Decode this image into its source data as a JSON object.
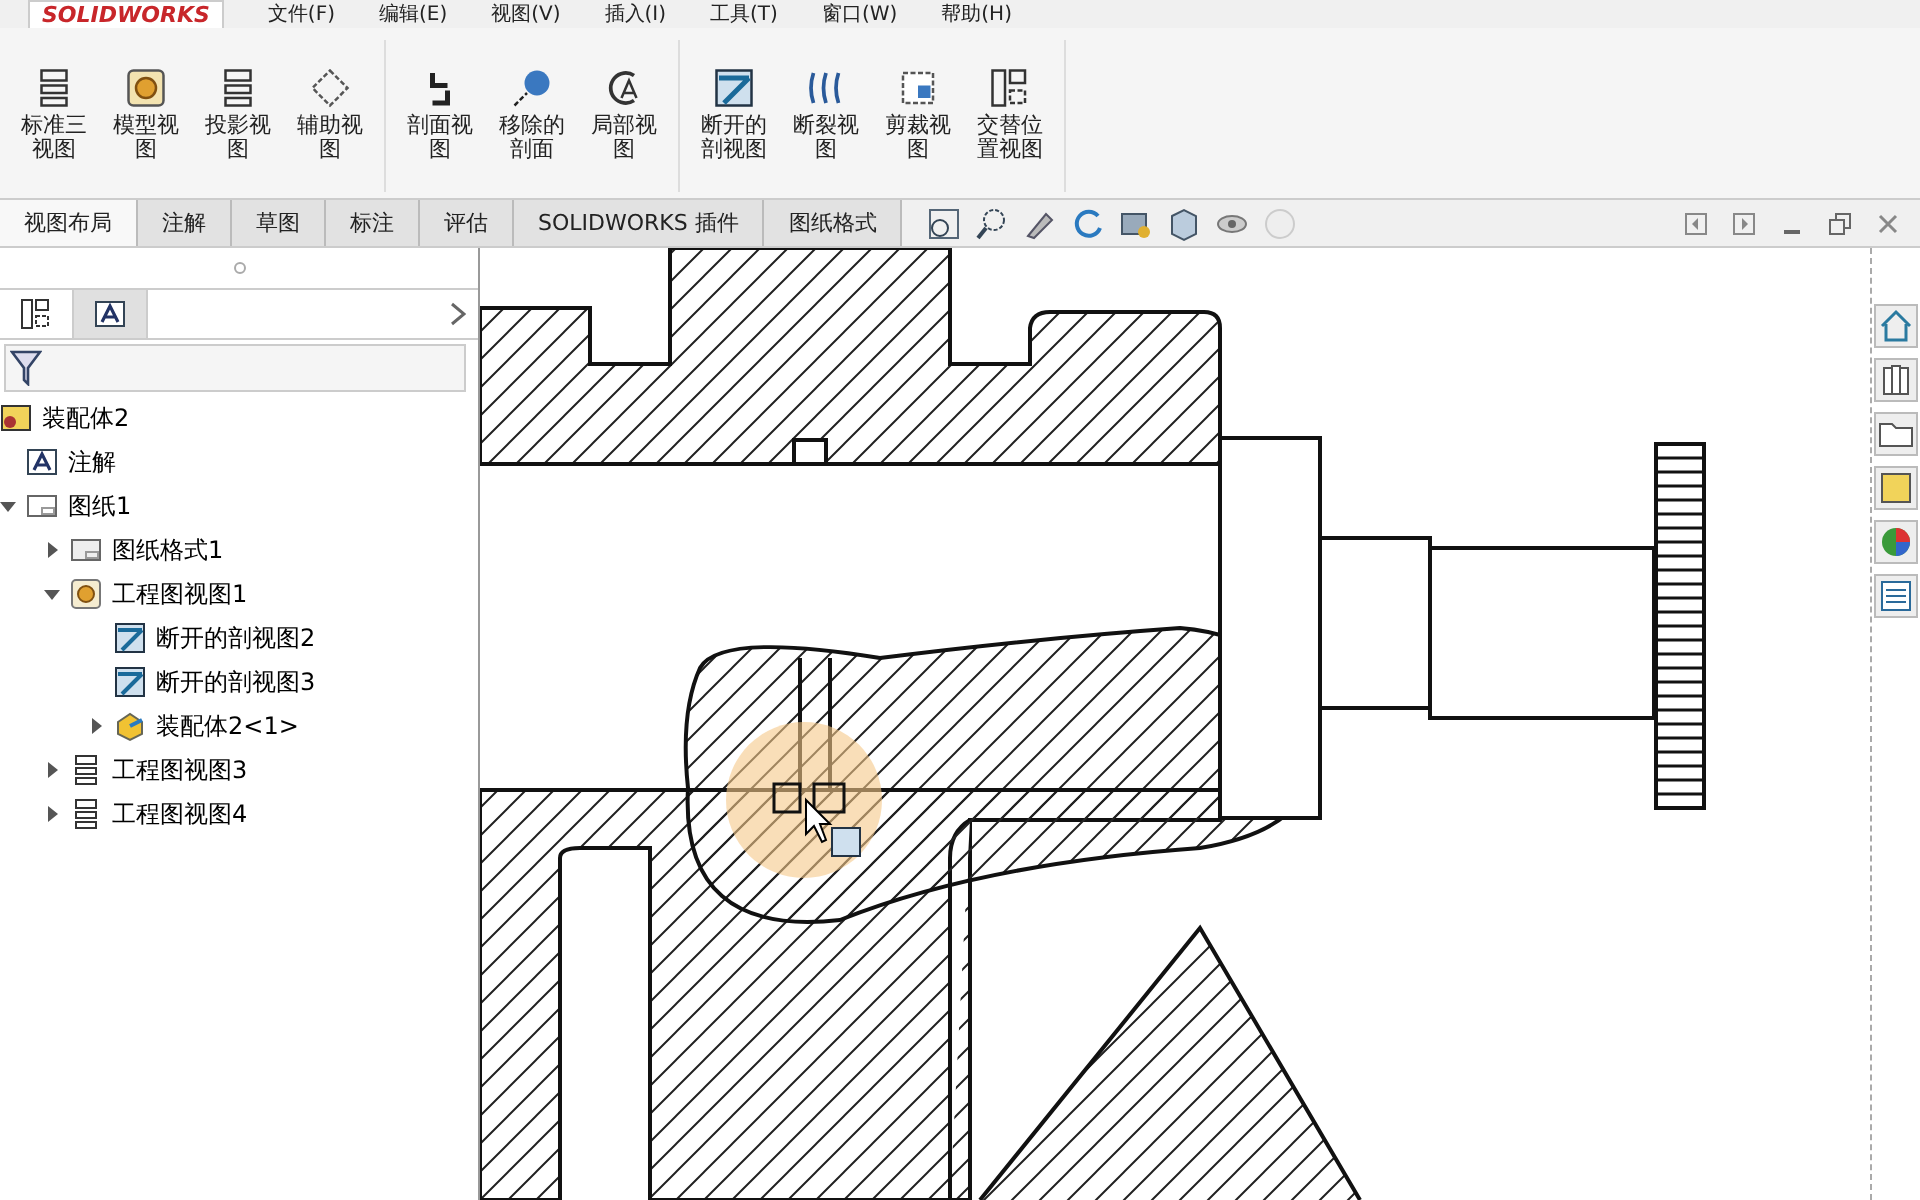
{
  "app": {
    "logo": "SOLIDWORKS"
  },
  "menu": [
    "文件(F)",
    "编辑(E)",
    "视图(V)",
    "插入(I)",
    "工具(T)",
    "窗口(W)",
    "帮助(H)"
  ],
  "ribbon": {
    "groups": [
      [
        {
          "label": "标准三视图",
          "kind": "std"
        },
        {
          "label": "模型视图",
          "kind": "model"
        },
        {
          "label": "投影视图",
          "kind": "std"
        },
        {
          "label": "辅助视图",
          "kind": "aux"
        }
      ],
      [
        {
          "label": "剖面视图",
          "kind": "section"
        },
        {
          "label": "移除的剖面",
          "kind": "removed"
        },
        {
          "label": "局部视图",
          "kind": "detail"
        }
      ],
      [
        {
          "label": "断开的剖视图",
          "kind": "broken"
        },
        {
          "label": "断裂视图",
          "kind": "break"
        },
        {
          "label": "剪裁视图",
          "kind": "crop"
        },
        {
          "label": "交替位置视图",
          "kind": "alt"
        }
      ]
    ]
  },
  "tabs": [
    {
      "label": "视图布局",
      "selected": true
    },
    {
      "label": "注解",
      "selected": false
    },
    {
      "label": "草图",
      "selected": false
    },
    {
      "label": "标注",
      "selected": false
    },
    {
      "label": "评估",
      "selected": false
    },
    {
      "label": "SOLIDWORKS 插件",
      "selected": false
    },
    {
      "label": "图纸格式",
      "selected": false
    }
  ],
  "feature_tree": {
    "root": {
      "label": "装配体2",
      "kind": "assembly",
      "children": [
        {
          "label": "注解",
          "kind": "annotation"
        },
        {
          "label": "图纸1",
          "kind": "sheet",
          "expanded": true,
          "children": [
            {
              "label": "图纸格式1",
              "kind": "format",
              "expanded": false
            },
            {
              "label": "工程图视图1",
              "kind": "view",
              "expanded": true,
              "children": [
                {
                  "label": "断开的剖视图2",
                  "kind": "broken"
                },
                {
                  "label": "断开的剖视图3",
                  "kind": "broken"
                },
                {
                  "label": "装配体2<1>",
                  "kind": "part",
                  "expanded": false
                }
              ]
            },
            {
              "label": "工程图视图3",
              "kind": "std",
              "expanded": false
            },
            {
              "label": "工程图视图4",
              "kind": "std",
              "expanded": false
            }
          ]
        }
      ]
    }
  }
}
